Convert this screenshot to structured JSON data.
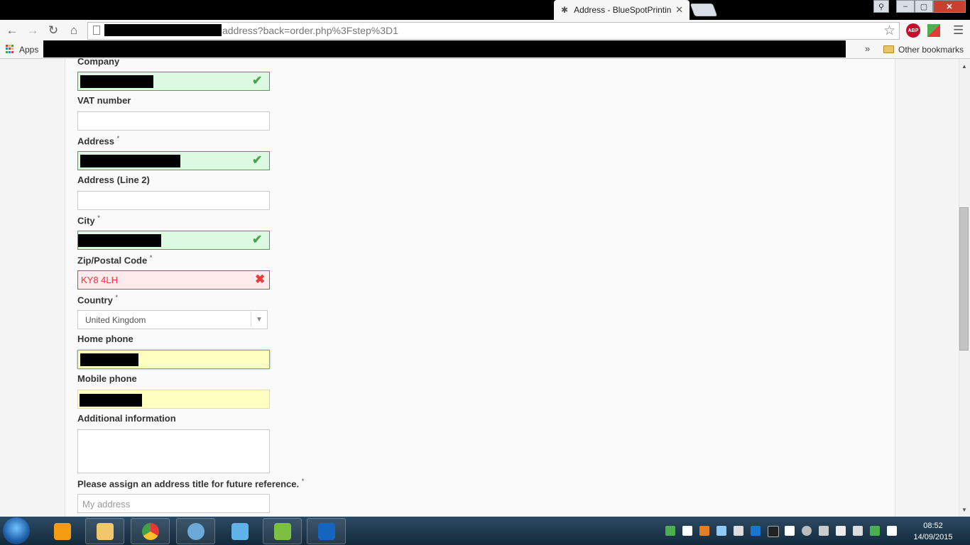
{
  "browser": {
    "tab_title": "Address - BlueSpotPrinting",
    "url_visible": "address?back=order.php%3Fstep%3D1",
    "bookmarks": {
      "apps_label": "Apps",
      "overflow": "»",
      "other_label": "Other bookmarks"
    },
    "extensions": {
      "adblock_label": "ABP"
    }
  },
  "form": {
    "company": {
      "label": "Company",
      "required": false,
      "status": "valid"
    },
    "vat": {
      "label": "VAT number",
      "value": ""
    },
    "address": {
      "label": "Address",
      "required_mark": "*",
      "status": "valid"
    },
    "address2": {
      "label": "Address (Line 2)",
      "value": ""
    },
    "city": {
      "label": "City",
      "required_mark": "*",
      "status": "valid"
    },
    "zip": {
      "label": "Zip/Postal Code",
      "required_mark": "*",
      "value": "KY8 4LH",
      "status": "invalid"
    },
    "country": {
      "label": "Country",
      "required_mark": "*",
      "selected": "United Kingdom"
    },
    "home_phone": {
      "label": "Home phone"
    },
    "mobile_phone": {
      "label": "Mobile phone"
    },
    "additional": {
      "label": "Additional information",
      "value": ""
    },
    "alias": {
      "label": "Please assign an address title for future reference.",
      "required_mark": "*",
      "placeholder": "My address"
    }
  },
  "taskbar": {
    "time": "08:52",
    "date": "14/09/2015"
  },
  "colors": {
    "valid_bg": "#ddf9e1",
    "valid_border": "#46a74e",
    "invalid_bg": "#ffebeb",
    "invalid_border": "#ea3a3a",
    "autofill_bg": "#ffffc0"
  }
}
